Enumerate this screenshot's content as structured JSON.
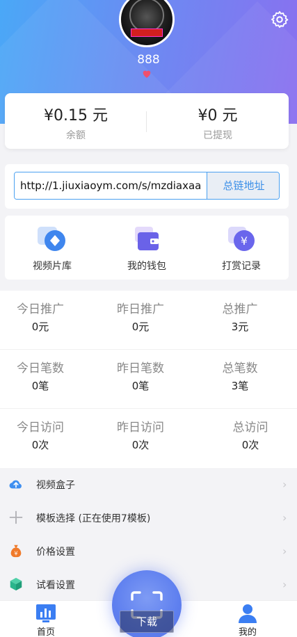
{
  "header": {
    "nickname": "888",
    "colors": {
      "gradient_start": "#4aa8f7",
      "gradient_end": "#8a6ff0"
    }
  },
  "balance": {
    "available_amount": "¥0.15 元",
    "available_label": "余额",
    "withdrawn_amount": "¥0 元",
    "withdrawn_label": "已提现"
  },
  "link": {
    "url": "http://1.jiuxiaoym.com/s/mzdiaxaa",
    "copy_label": "总链地址"
  },
  "quick_actions": [
    {
      "label": "视频片库",
      "icon": "diamond-icon"
    },
    {
      "label": "我的钱包",
      "icon": "wallet-icon"
    },
    {
      "label": "打赏记录",
      "icon": "yen-coin-icon"
    }
  ],
  "stats": [
    [
      {
        "title": "今日推广",
        "value": "0元"
      },
      {
        "title": "昨日推广",
        "value": "0元"
      },
      {
        "title": "总推广",
        "value": "3元"
      }
    ],
    [
      {
        "title": "今日笔数",
        "value": "0笔"
      },
      {
        "title": "昨日笔数",
        "value": "0笔"
      },
      {
        "title": "总笔数",
        "value": "3笔"
      }
    ],
    [
      {
        "title": "今日访问",
        "value": "0次"
      },
      {
        "title": "昨日访问",
        "value": "0次"
      },
      {
        "title": "总访问",
        "value": "0次"
      }
    ]
  ],
  "menu": [
    {
      "label": "视频盒子",
      "icon": "cloud-upload-icon"
    },
    {
      "label": "模板选择 (正在使用7模板)",
      "icon": "plus-icon"
    },
    {
      "label": "价格设置",
      "icon": "money-bag-icon"
    },
    {
      "label": "试看设置",
      "icon": "cube-icon"
    }
  ],
  "tabbar": {
    "home_label": "首页",
    "download_label": "下载",
    "mine_label": "我的"
  },
  "accent": "#3b8fe8"
}
